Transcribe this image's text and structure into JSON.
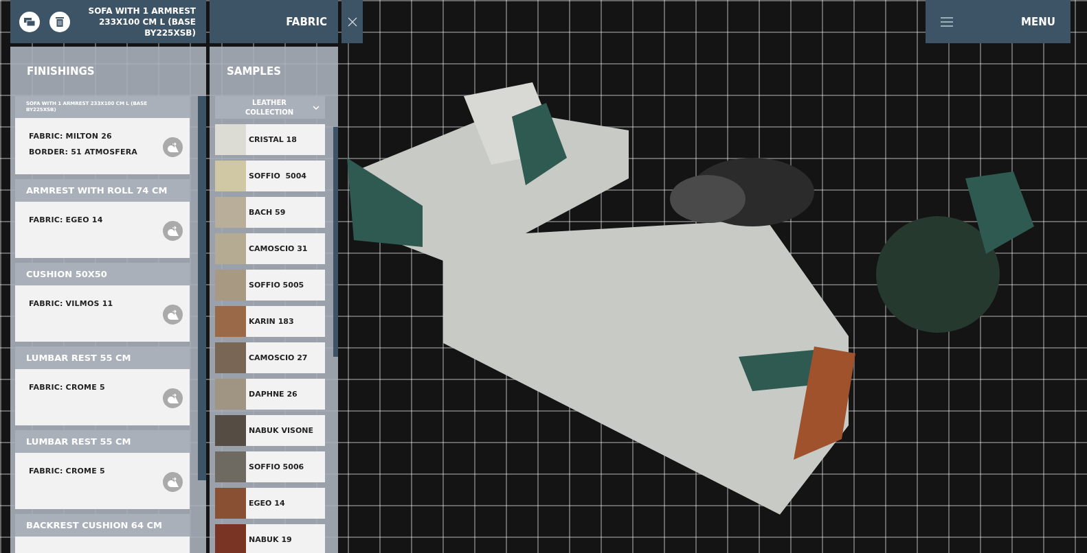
{
  "header": {
    "title": "SOFA WITH 1 ARMREST 233X100 CM L (BASE BY225XSB)",
    "section": "FABRIC",
    "menu": "MENU"
  },
  "finishings": {
    "title": "FINISHINGS",
    "items": [
      {
        "kind": "small",
        "name": "SOFA WITH 1 ARMREST 233X100 CM L (BASE BY225XSB)",
        "lines": [
          "FABRIC: MILTON 26",
          "BORDER: 51 ATMOSFERA"
        ]
      },
      {
        "kind": "large",
        "name": "ARMREST WITH ROLL 74 CM",
        "lines": [
          "FABRIC: EGEO 14"
        ]
      },
      {
        "kind": "large",
        "name": "CUSHION 50X50",
        "lines": [
          "FABRIC: VILMOS 11"
        ]
      },
      {
        "kind": "large",
        "name": "LUMBAR REST 55 CM",
        "lines": [
          "FABRIC: CROME 5"
        ]
      },
      {
        "kind": "large",
        "name": "LUMBAR REST 55 CM",
        "lines": [
          "FABRIC: CROME 5"
        ]
      },
      {
        "kind": "large",
        "name": "BACKREST CUSHION 64 CM"
      }
    ]
  },
  "samples": {
    "title": "SAMPLES",
    "collection": "LEATHER COLLECTION",
    "items": [
      {
        "name": "CRISTAL 18",
        "color": "#dcdcd4"
      },
      {
        "name": "SOFFIO  5004",
        "color": "#d0c8a4"
      },
      {
        "name": "BACH 59",
        "color": "#b8ae9a"
      },
      {
        "name": "CAMOSCIO 31",
        "color": "#b5aa92"
      },
      {
        "name": "SOFFIO 5005",
        "color": "#a89a82"
      },
      {
        "name": "KARIN 183",
        "color": "#9a6a48"
      },
      {
        "name": "CAMOSCIO 27",
        "color": "#7a6654"
      },
      {
        "name": "DAPHNE 26",
        "color": "#a09482"
      },
      {
        "name": "NABUK VISONE",
        "color": "#554c44"
      },
      {
        "name": "SOFFIO 5006",
        "color": "#6e6a62"
      },
      {
        "name": "EGEO 14",
        "color": "#8a5034"
      },
      {
        "name": "NABUK 19",
        "color": "#7a3424"
      }
    ]
  }
}
